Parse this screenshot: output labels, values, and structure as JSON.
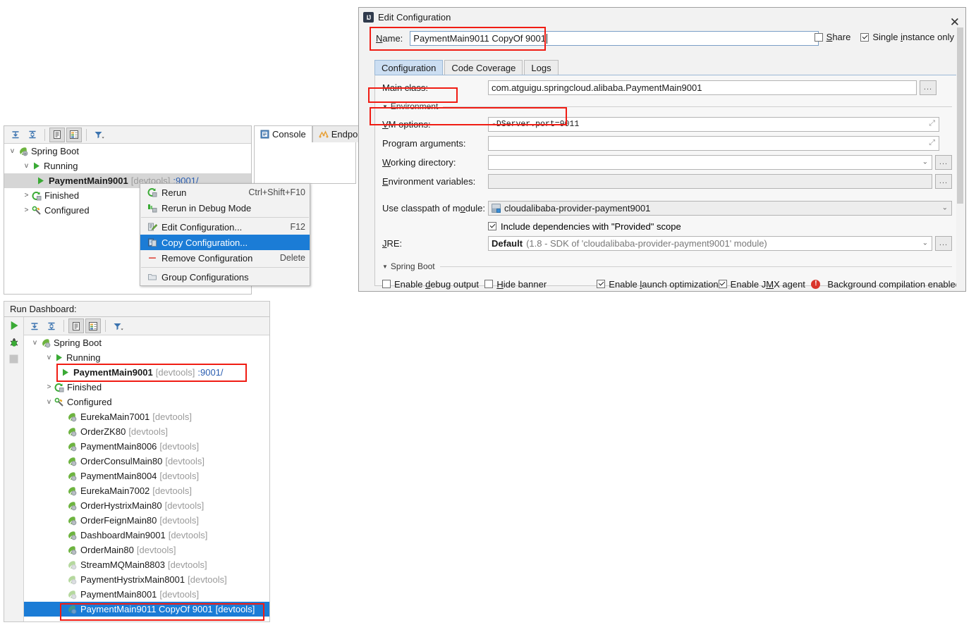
{
  "upper_panel": {
    "toolbar": {
      "expand_all": "expand-all-icon",
      "collapse_all": "collapse-all-icon",
      "show_config": "show-configurations-icon",
      "group_by_type": "group-by-type-icon",
      "filter": "filter-icon"
    },
    "tree": [
      {
        "label": "Spring Boot",
        "chevron": "v",
        "icon": "spring-boot-icon",
        "indent": 0
      },
      {
        "label": "Running",
        "chevron": "v",
        "icon": "run-green-icon",
        "indent": 1
      },
      {
        "label": "PaymentMain9001",
        "suffix": "[devtools]",
        "port": ":9001/",
        "chevron": "",
        "icon": "run-green-icon",
        "indent": 2,
        "selected": true
      },
      {
        "label": "Finished",
        "chevron": ">",
        "icon": "rerun-icon",
        "indent": 1
      },
      {
        "label": "Configured",
        "chevron": ">",
        "icon": "wrench-icon",
        "indent": 1
      }
    ],
    "console_tabs": [
      {
        "label": "Console",
        "icon": "console-icon",
        "active": true
      },
      {
        "label": "Endpoints",
        "icon": "endpoints-icon",
        "active": false
      }
    ]
  },
  "context_menu": {
    "items": [
      {
        "label": "Rerun",
        "shortcut": "Ctrl+Shift+F10",
        "icon": "rerun-icon",
        "highlighted": false
      },
      {
        "label": "Rerun in Debug Mode",
        "shortcut": "",
        "icon": "debug-rerun-icon",
        "highlighted": false
      },
      {
        "separator": true
      },
      {
        "label": "Edit Configuration...",
        "shortcut": "F12",
        "icon": "edit-config-icon",
        "highlighted": false
      },
      {
        "label": "Copy Configuration...",
        "shortcut": "",
        "icon": "copy-config-icon",
        "highlighted": true
      },
      {
        "label": "Remove Configuration",
        "shortcut": "Delete",
        "icon": "remove-config-icon",
        "highlighted": false
      },
      {
        "separator": true
      },
      {
        "label": "Group Configurations",
        "shortcut": "",
        "icon": "group-config-icon",
        "highlighted": false
      }
    ]
  },
  "dialog": {
    "title": "Edit Configuration",
    "icon": "intellij-idea-icon",
    "close": "✕",
    "name_label": "Name:",
    "name_value": "PaymentMain9011 CopyOf 9001",
    "share_label": "Share",
    "share_checked": false,
    "single_instance_label": "Single instance only",
    "single_instance_checked": true,
    "tabs": [
      {
        "label": "Configuration",
        "active": true
      },
      {
        "label": "Code Coverage",
        "active": false
      },
      {
        "label": "Logs",
        "active": false
      }
    ],
    "fields": {
      "main_class_label": "Main class:",
      "main_class_value": "com.atguigu.springcloud.alibaba.PaymentMain9001",
      "environment_section": "Environment",
      "vm_options_label": "VM options:",
      "vm_options_value": "-DServer.port=9011",
      "program_arguments_label": "Program arguments:",
      "program_arguments_value": "",
      "working_directory_label": "Working directory:",
      "working_directory_value": "",
      "environment_variables_label": "Environment variables:",
      "environment_variables_value": "",
      "classpath_label": "Use classpath of module:",
      "classpath_value": "cloudalibaba-provider-payment9001",
      "include_deps_label": "Include dependencies with \"Provided\" scope",
      "include_deps_checked": true,
      "jre_label": "JRE:",
      "jre_value_bold": "Default",
      "jre_value_rest": "(1.8 - SDK of 'cloudalibaba-provider-payment9001' module)",
      "spring_boot_section": "Spring Boot",
      "enable_debug_output_label": "Enable debug output",
      "enable_debug_output_checked": false,
      "hide_banner_label": "Hide banner",
      "hide_banner_checked": false,
      "enable_launch_opt_label": "Enable launch optimization",
      "enable_launch_opt_checked": true,
      "enable_jmx_label": "Enable JMX agent",
      "enable_jmx_checked": true,
      "background_compilation_label": "Background compilation enabled",
      "dots_button": "...",
      "browse_button": "..."
    }
  },
  "run_dashboard": {
    "title": "Run Dashboard:",
    "gutter": [
      {
        "icon": "run-green-icon",
        "name": "run-button"
      },
      {
        "icon": "debug-bug-icon",
        "name": "debug-button"
      },
      {
        "icon": "stop-square-icon",
        "name": "stop-button"
      }
    ],
    "toolbar": {
      "expand_all": "expand-all-icon",
      "collapse_all": "collapse-all-icon",
      "show_config": "show-configurations-icon",
      "group_by_type": "group-by-type-icon",
      "filter": "filter-icon"
    },
    "tree": {
      "root": {
        "label": "Spring Boot",
        "chevron": "v",
        "icon": "spring-boot-icon"
      },
      "running": {
        "label": "Running",
        "chevron": "v",
        "icon": "run-green-icon"
      },
      "running_item": {
        "label": "PaymentMain9001",
        "suffix": "[devtools]",
        "port": ":9001/",
        "icon": "run-green-icon"
      },
      "finished": {
        "label": "Finished",
        "chevron": ">",
        "icon": "rerun-icon"
      },
      "configured": {
        "label": "Configured",
        "chevron": "v",
        "icon": "wrench-icon"
      },
      "configured_items": [
        {
          "label": "EurekaMain7001",
          "suffix": "[devtools]",
          "icon": "spring-boot-icon",
          "dim": false,
          "selected": false
        },
        {
          "label": "OrderZK80",
          "suffix": "[devtools]",
          "icon": "spring-boot-icon",
          "dim": false,
          "selected": false
        },
        {
          "label": "PaymentMain8006",
          "suffix": "[devtools]",
          "icon": "spring-boot-icon",
          "dim": false,
          "selected": false
        },
        {
          "label": "OrderConsulMain80",
          "suffix": "[devtools]",
          "icon": "spring-boot-icon",
          "dim": false,
          "selected": false
        },
        {
          "label": "PaymentMain8004",
          "suffix": "[devtools]",
          "icon": "spring-boot-icon",
          "dim": false,
          "selected": false
        },
        {
          "label": "EurekaMain7002",
          "suffix": "[devtools]",
          "icon": "spring-boot-icon",
          "dim": false,
          "selected": false
        },
        {
          "label": "OrderHystrixMain80",
          "suffix": "[devtools]",
          "icon": "spring-boot-icon",
          "dim": false,
          "selected": false
        },
        {
          "label": "OrderFeignMain80",
          "suffix": "[devtools]",
          "icon": "spring-boot-icon",
          "dim": false,
          "selected": false
        },
        {
          "label": "DashboardMain9001",
          "suffix": "[devtools]",
          "icon": "spring-boot-icon",
          "dim": false,
          "selected": false
        },
        {
          "label": "OrderMain80",
          "suffix": "[devtools]",
          "icon": "spring-boot-icon",
          "dim": false,
          "selected": false
        },
        {
          "label": "StreamMQMain8803",
          "suffix": "[devtools]",
          "icon": "spring-boot-icon",
          "dim": true,
          "selected": false
        },
        {
          "label": "PaymentHystrixMain8001",
          "suffix": "[devtools]",
          "icon": "spring-boot-icon",
          "dim": true,
          "selected": false
        },
        {
          "label": "PaymentMain8001",
          "suffix": "[devtools]",
          "icon": "spring-boot-icon",
          "dim": true,
          "selected": false
        },
        {
          "label": "PaymentMain9011 CopyOf 9001",
          "suffix": "[devtools]",
          "icon": "spring-boot-icon",
          "dim": true,
          "selected": true
        }
      ]
    }
  },
  "colors": {
    "accent_blue": "#1b7cd6",
    "annotation_red": "#f01c13",
    "green_run": "#39a93b",
    "link_blue": "#2a5db0",
    "dim_gray": "#9b9b9b"
  }
}
